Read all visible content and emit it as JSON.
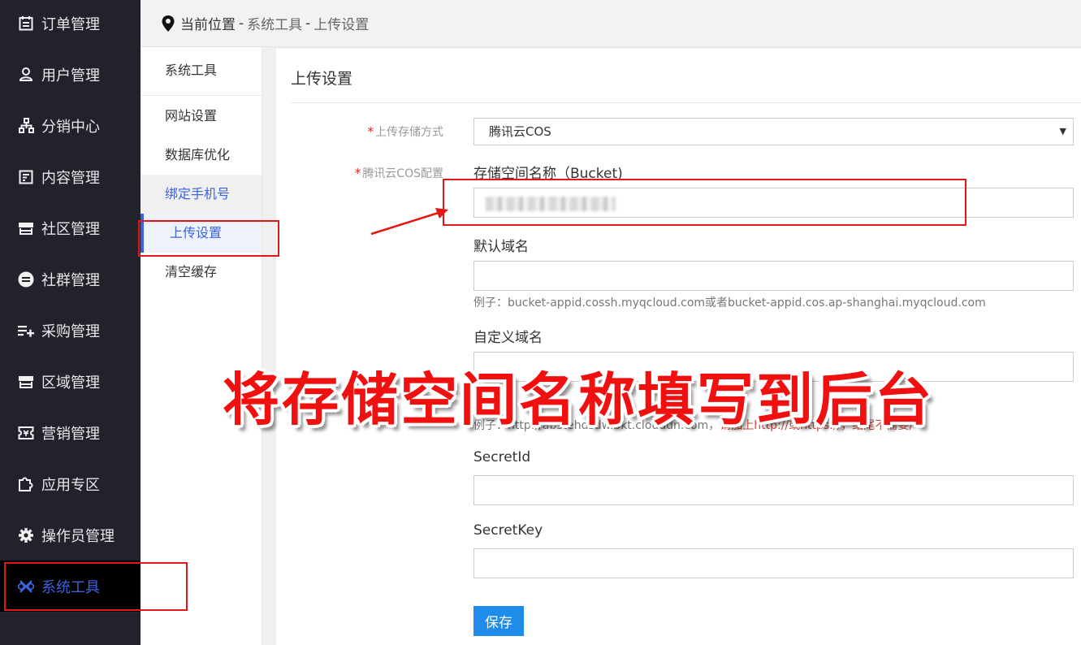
{
  "sidebar": {
    "items": [
      {
        "label": "订单管理",
        "icon": "calendar-icon"
      },
      {
        "label": "用户管理",
        "icon": "user-icon"
      },
      {
        "label": "分销中心",
        "icon": "org-chart-icon"
      },
      {
        "label": "内容管理",
        "icon": "document-icon"
      },
      {
        "label": "社区管理",
        "icon": "store-icon"
      },
      {
        "label": "社群管理",
        "icon": "minus-circle-icon"
      },
      {
        "label": "采购管理",
        "icon": "list-add-icon"
      },
      {
        "label": "区域管理",
        "icon": "store-icon"
      },
      {
        "label": "营销管理",
        "icon": "ticket-icon"
      },
      {
        "label": "应用专区",
        "icon": "puzzle-icon"
      },
      {
        "label": "操作员管理",
        "icon": "gear-icon"
      },
      {
        "label": "系统工具",
        "icon": "tools-icon",
        "active": true
      }
    ]
  },
  "breadcrumb": {
    "current": "当前位置",
    "sep": "-",
    "level1": "系统工具",
    "level2": "上传设置"
  },
  "submenu": {
    "header": "系统工具",
    "items": [
      "网站设置",
      "数据库优化",
      "绑定手机号",
      "上传设置",
      "清空缓存"
    ]
  },
  "panel": {
    "title": "上传设置",
    "storage_label": "上传存储方式",
    "storage_value": "腾讯云COS",
    "cos_label": "腾讯云COS配置",
    "bucket_label": "存储空间名称（Bucket)",
    "default_domain_label": "默认域名",
    "default_domain_hint": "例子：bucket-appid.cossh.myqcloud.com或者bucket-appid.cos.ap-shanghai.myqcloud.com",
    "custom_domain_label": "自定义域名",
    "custom_domain_hint": "例子：http://abstehdsdw.bkt.clouddn.com，",
    "custom_domain_warn": "请加上http://或https://，结尾不需要/",
    "secret_id_label": "SecretId",
    "secret_key_label": "SecretKey",
    "save_label": "保存"
  },
  "annotation": {
    "caption": "将存储空间名称填写到后台"
  },
  "colors": {
    "sidebar_bg": "#22222c",
    "accent": "#3b63e0",
    "button": "#1e8ce8",
    "annotation": "#e51616"
  }
}
